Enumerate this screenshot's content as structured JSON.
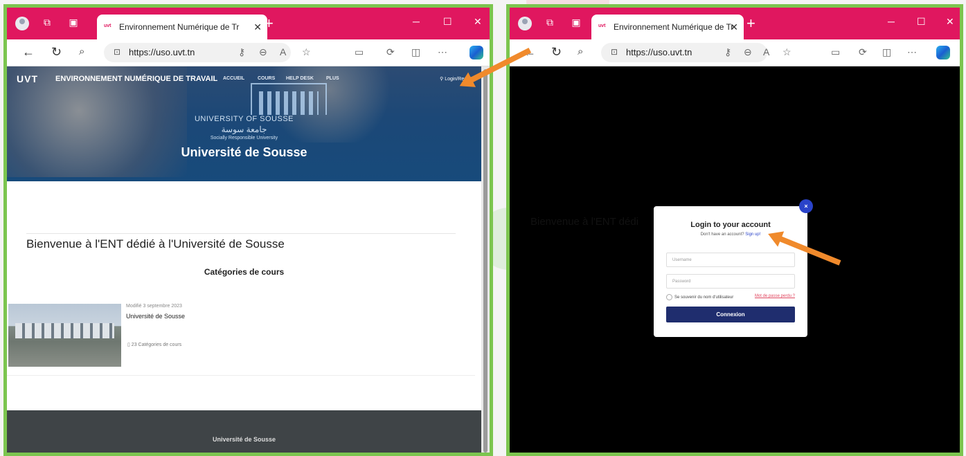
{
  "left_window": {
    "tab_title": "Environnement Numérique de Tr",
    "url": "https://uso.uvt.tn",
    "site": {
      "logo": "UVT",
      "name": "ENVIRONNEMENT NUMÉRIQUE DE TRAVAIL",
      "menu": [
        "ACCUEIL",
        "COURS",
        "HELP DESK",
        "PLUS"
      ],
      "login_link": "Login/Registe"
    },
    "hero": {
      "university_en": "UNIVERSITY OF SOUSSE",
      "university_ar": "جامعة سوسة",
      "tagline": "Socially Responsible University",
      "title": "Université de Sousse"
    },
    "welcome": "Bienvenue à l'ENT dédié à l'Université de Sousse",
    "categories_heading": "Catégories de cours",
    "course": {
      "modified": "Modifié 3 septembre 2023",
      "title": "Université de Sousse",
      "count": "23 Catégories de cours"
    },
    "footer": "Université de Sousse"
  },
  "right_window": {
    "tab_title": "Environnement Numérique de Tr",
    "url": "https://uso.uvt.tn",
    "background_text": "Bienvenue à l'ENT dédi",
    "modal": {
      "close": "×",
      "title": "Login to your account",
      "subtitle_prefix": "Don't have an account?",
      "signup_link": "Sign up!",
      "username_placeholder": "Username",
      "password_placeholder": "Password",
      "remember": "Se souvenir du nom d'utilisateur",
      "lost_password": "Mot de passe perdu ?",
      "submit": "Connexion"
    }
  },
  "colors": {
    "titlebar": "#e0175f",
    "panel_border": "#7cc54f",
    "arrow": "#f08a2c",
    "login_button": "#1f2d6e",
    "link": "#2a43c9"
  }
}
